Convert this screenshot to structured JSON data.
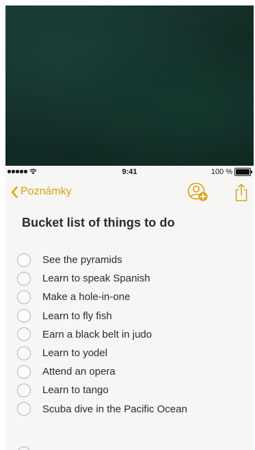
{
  "status_bar": {
    "time": "9:41",
    "battery": "100 %"
  },
  "nav": {
    "back_label": "Poznámky",
    "back_icon": "chevron-left-icon",
    "collab_icon": "add-person-icon",
    "share_icon": "share-icon"
  },
  "colors": {
    "accent": "#d7a217",
    "backdrop": "#16342d",
    "paper": "#f6f6f4"
  },
  "note": {
    "title": "Bucket list of things to do",
    "items": [
      {
        "text": "See the pyramids",
        "checked": false
      },
      {
        "text": "Learn to speak Spanish",
        "checked": false
      },
      {
        "text": "Make a hole-in-one",
        "checked": false
      },
      {
        "text": "Learn to fly fish",
        "checked": false
      },
      {
        "text": "Earn a black belt in judo",
        "checked": false
      },
      {
        "text": "Learn to yodel",
        "checked": false
      },
      {
        "text": "Attend an opera",
        "checked": false
      },
      {
        "text": "Learn to tango",
        "checked": false
      },
      {
        "text": "Scuba dive in the Pacific Ocean",
        "checked": false
      }
    ]
  }
}
